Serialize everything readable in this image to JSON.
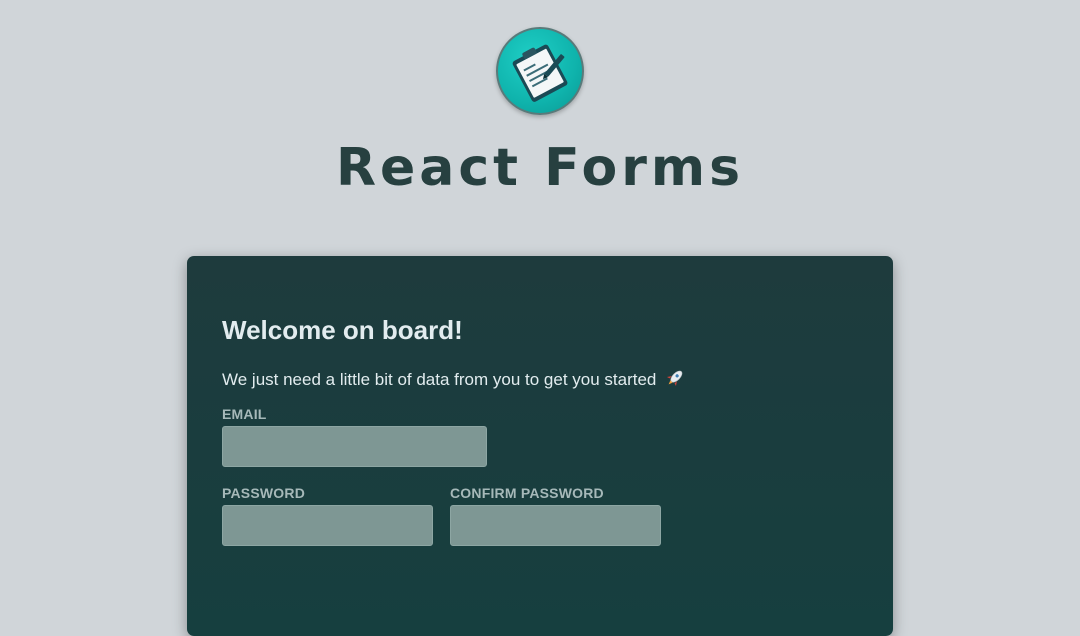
{
  "app": {
    "title": "React Forms",
    "logo_icon": "clipboard-icon"
  },
  "form": {
    "heading": "Welcome on board!",
    "subtitle": "We just need a little bit of data from you to get you started",
    "subtitle_icon": "rocket-icon",
    "fields": {
      "email": {
        "label": "EMAIL",
        "value": "",
        "placeholder": ""
      },
      "password": {
        "label": "PASSWORD",
        "value": "",
        "placeholder": ""
      },
      "confirm_password": {
        "label": "CONFIRM PASSWORD",
        "value": "",
        "placeholder": ""
      }
    }
  },
  "colors": {
    "page_bg": "#d0d5d9",
    "title": "#274040",
    "card_bg": "#1c3d3e",
    "input_bg": "#7e9794",
    "label": "#a6b9b9",
    "logo": "#12bcb4"
  }
}
